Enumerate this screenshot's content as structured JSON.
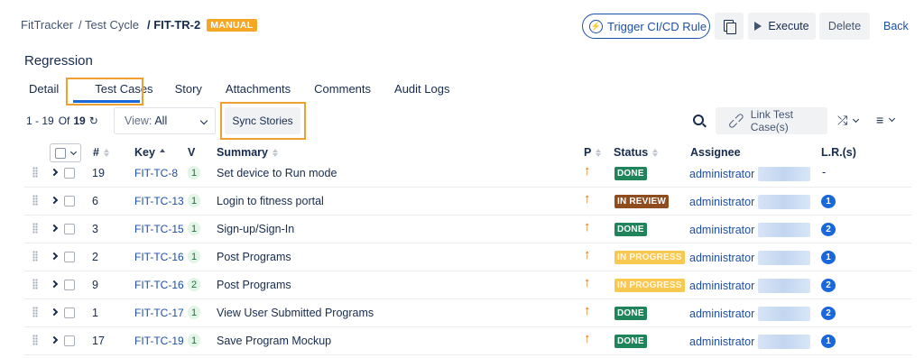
{
  "breadcrumb": {
    "project": "FitTracker",
    "section": "/ Test Cycle",
    "key": "/ FIT-TR-2",
    "badge": "MANUAL"
  },
  "actions": {
    "trigger": "Trigger CI/CD Rule",
    "execute": "Execute",
    "delete": "Delete",
    "back": "Back"
  },
  "page_title": "Regression",
  "tabs": [
    {
      "label": "Detail"
    },
    {
      "label": "Test Cases",
      "active": true
    },
    {
      "label": "Story"
    },
    {
      "label": "Attachments"
    },
    {
      "label": "Comments"
    },
    {
      "label": "Audit Logs"
    }
  ],
  "toolbar": {
    "range": "1 - 19",
    "of": "Of",
    "total": "19",
    "view_label": "View:",
    "view_value": "All",
    "sync": "Sync Stories",
    "link": "Link Test Case(s)"
  },
  "columns": {
    "num": "#",
    "key": "Key",
    "version": "V",
    "summary": "Summary",
    "priority": "P",
    "status": "Status",
    "assignee": "Assignee",
    "last_run": "L.R.(s)"
  },
  "rows": [
    {
      "num": "19",
      "key": "FIT-TC-8",
      "ver": "1",
      "summary": "Set device to Run mode",
      "status": "DONE",
      "status_type": "done",
      "assignee": "administrator",
      "lr": "-"
    },
    {
      "num": "6",
      "key": "FIT-TC-13",
      "ver": "1",
      "summary": "Login to fitness portal",
      "status": "IN REVIEW",
      "status_type": "review",
      "assignee": "administrator",
      "lr": "1"
    },
    {
      "num": "3",
      "key": "FIT-TC-15",
      "ver": "1",
      "summary": "Sign-up/Sign-In",
      "status": "DONE",
      "status_type": "done",
      "assignee": "administrator",
      "lr": "2"
    },
    {
      "num": "2",
      "key": "FIT-TC-16",
      "ver": "1",
      "summary": "Post Programs",
      "status": "IN PROGRESS",
      "status_type": "prog",
      "assignee": "administrator",
      "lr": "1"
    },
    {
      "num": "9",
      "key": "FIT-TC-16",
      "ver": "2",
      "summary": "Post Programs",
      "status": "IN PROGRESS",
      "status_type": "prog",
      "assignee": "administrator",
      "lr": "2"
    },
    {
      "num": "1",
      "key": "FIT-TC-17",
      "ver": "1",
      "summary": "View User Submitted Programs",
      "status": "DONE",
      "status_type": "done",
      "assignee": "administrator",
      "lr": "2"
    },
    {
      "num": "17",
      "key": "FIT-TC-19",
      "ver": "1",
      "summary": "Save Program Mockup",
      "status": "DONE",
      "status_type": "done",
      "assignee": "administrator",
      "lr": "1"
    }
  ],
  "colors": {
    "accent": "#1868db",
    "highlight_box": "#f0a030",
    "done": "#1f845a",
    "in_review": "#8f4c1e",
    "in_progress": "#f8c850",
    "priority": "#e2740c"
  }
}
